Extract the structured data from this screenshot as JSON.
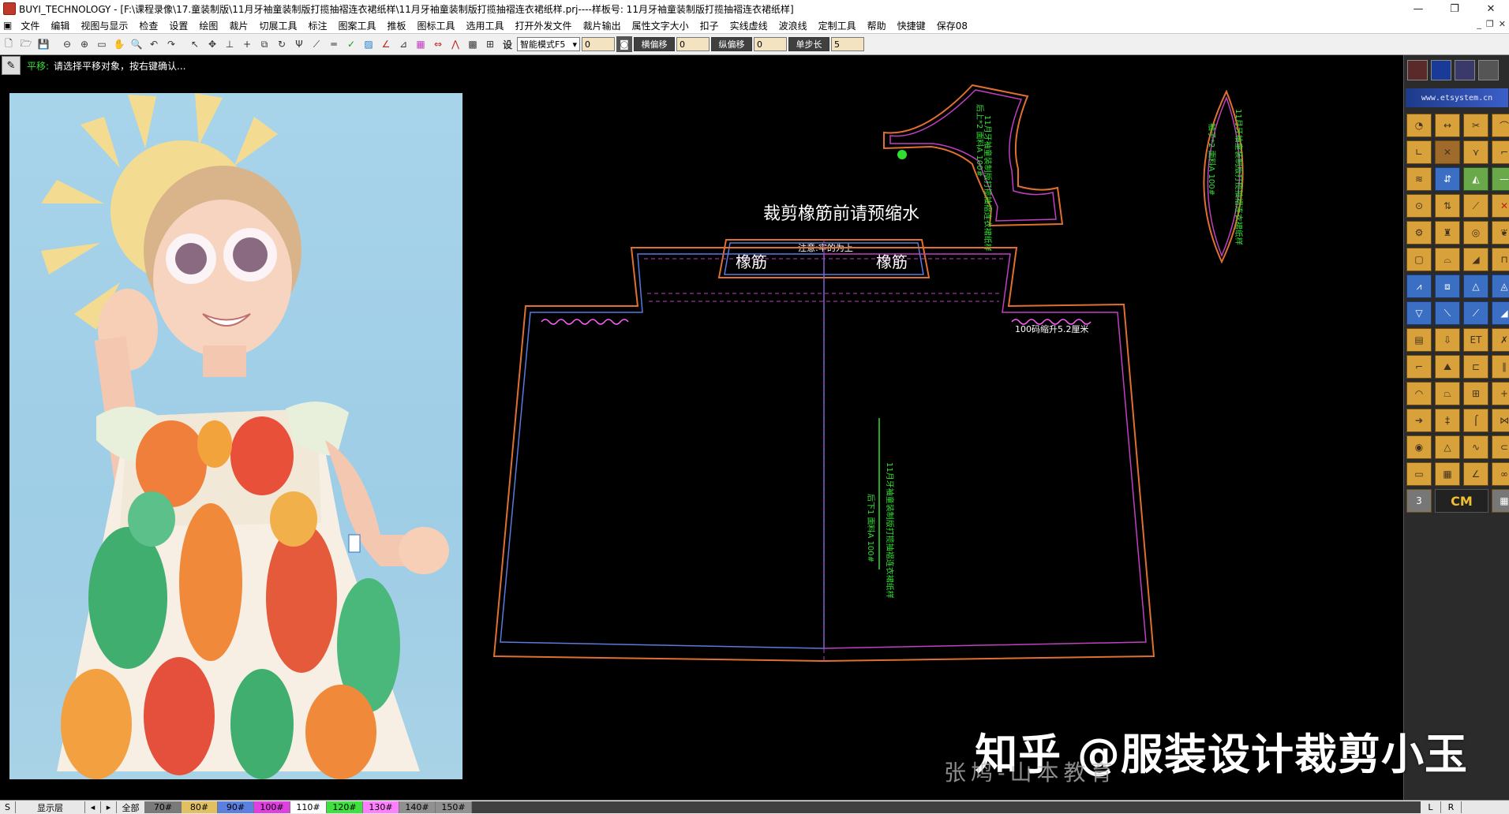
{
  "window": {
    "title": "BUYI_TECHNOLOGY - [F:\\课程录像\\17.童装制版\\11月牙袖童装制版打揽抽褶连衣裙纸样\\11月牙袖童装制版打揽抽褶连衣裙纸样.prj----样板号: 11月牙袖童装制版打揽抽褶连衣裙纸样]",
    "controls": [
      "—",
      "❐",
      "✕"
    ]
  },
  "menu": {
    "items": [
      "文件",
      "编辑",
      "视图与显示",
      "检查",
      "设置",
      "绘图",
      "裁片",
      "切展工具",
      "标注",
      "图案工具",
      "推板",
      "图标工具",
      "选用工具",
      "打开外发文件",
      "裁片输出",
      "属性文字大小",
      "扣子",
      "实线虚线",
      "波浪线",
      "定制工具",
      "帮助",
      "快捷键",
      "保存08"
    ],
    "mdi_controls": [
      "_",
      "❐",
      "✕"
    ]
  },
  "toolbar": {
    "mode_select": "智能模式F5",
    "value1": "0",
    "h_offset_label": "横偏移",
    "h_offset_value": "0",
    "v_offset_label": "纵偏移",
    "v_offset_value": "0",
    "step_label": "单步长",
    "step_value": "5"
  },
  "status": {
    "command": "平移:",
    "prompt": "请选择平移对象，按右键确认..."
  },
  "canvas": {
    "elastic_title": "裁剪橡筋前请预缩水",
    "elastic_left": "橡筋",
    "elastic_right": "橡筋",
    "elastic_note": "注意:牢的为上",
    "smock_note": "100码缩升5.2厘米",
    "skirt_label1": "11月牙袖童装制版打揽抽褶连衣裙纸样",
    "skirt_label2": "后下1 面料A 100#",
    "bodice_label": "11月牙袖童装制版打揽抽褶连衣裙纸样",
    "bodice_label2": "后上*2 面料A 100#",
    "sleeve_label": "11月牙袖童装制版打揽抽褶连衣裙纸样",
    "sleeve_label2": "袖子*2 面料A 100#"
  },
  "right_panel": {
    "brand": "www.etsystem.cn",
    "cm_label": "CM"
  },
  "bottom": {
    "s_label": "S",
    "layer_label": "显示层",
    "all_label": "全部",
    "sizes": [
      "70#",
      "80#",
      "90#",
      "100#",
      "110#",
      "120#",
      "130#",
      "140#",
      "150#"
    ],
    "size_colors": [
      "#7a7a7a",
      "#e0c060",
      "#5b80e0",
      "#e040e0",
      "#ffffff",
      "#40e040",
      "#ff80ff",
      "#909090",
      "#909090"
    ],
    "right_l": "L",
    "right_r": "R"
  },
  "watermark": {
    "main": "知乎 @服装设计裁剪小玉",
    "secondary": "张鸠-山本教育"
  }
}
